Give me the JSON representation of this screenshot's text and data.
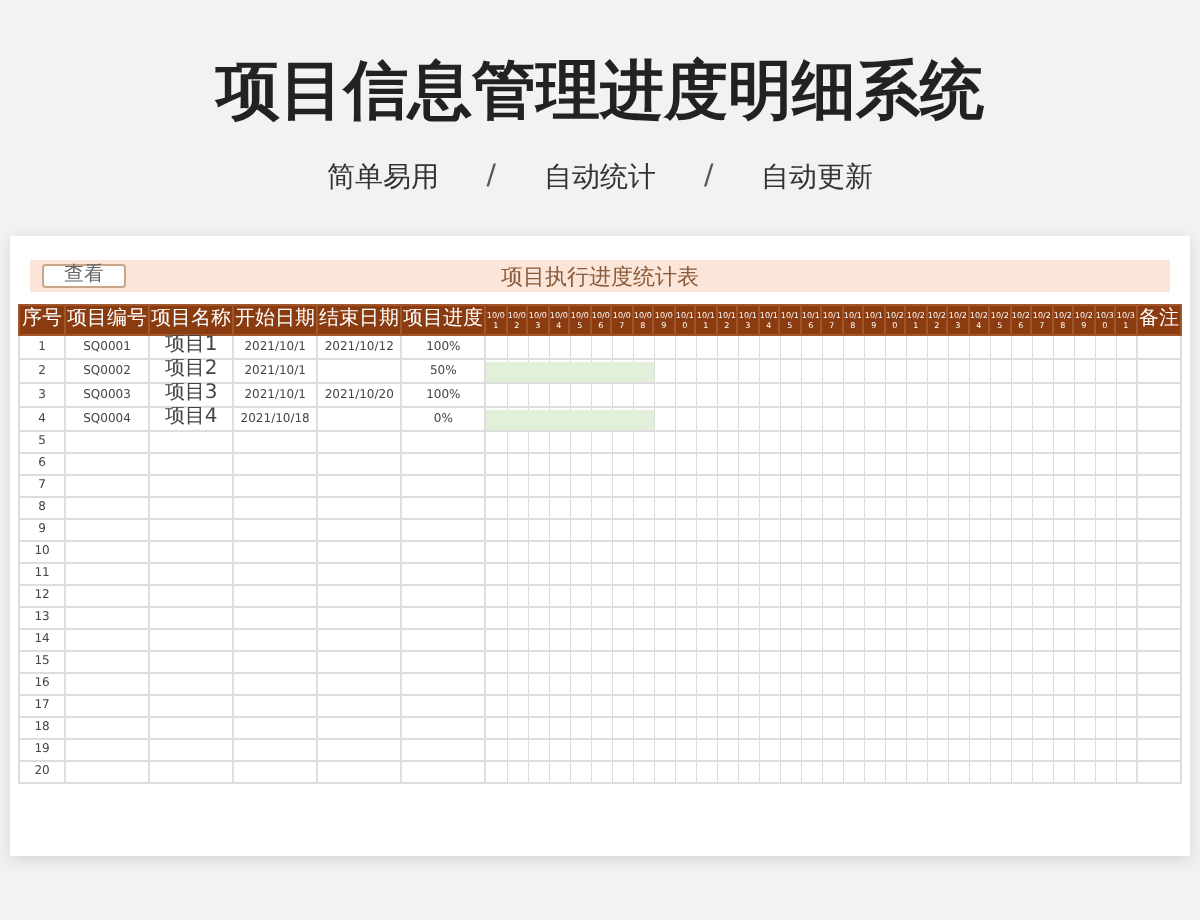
{
  "title": "项目信息管理进度明细系统",
  "features": [
    "简单易用",
    "自动统计",
    "自动更新"
  ],
  "separators": [
    "/",
    "/"
  ],
  "sheet": {
    "button": "查看",
    "title": "项目执行进度统计表",
    "columns": [
      "序号",
      "项目编号",
      "项目名称",
      "开始日期",
      "结束日期",
      "项目进度"
    ],
    "days": [
      "10/01",
      "10/02",
      "10/03",
      "10/04",
      "10/05",
      "10/06",
      "10/07",
      "10/08",
      "10/09",
      "10/10",
      "10/11",
      "10/12",
      "10/13",
      "10/14",
      "10/15",
      "10/16",
      "10/17",
      "10/18",
      "10/19",
      "10/20",
      "10/21",
      "10/22",
      "10/23",
      "10/24",
      "10/25",
      "10/26",
      "10/27",
      "10/28",
      "10/29",
      "10/30",
      "10/31"
    ],
    "note_column": "备注",
    "rows": [
      {
        "no": "1",
        "code": "SQ0001",
        "name": "项目1",
        "start": "2021/10/1",
        "end": "2021/10/12",
        "progress": "100%"
      },
      {
        "no": "2",
        "code": "SQ0002",
        "name": "项目2",
        "start": "2021/10/1",
        "progress": "50%",
        "level": 0.258
      },
      {
        "no": "3",
        "code": "SQ0003",
        "name": "项目3",
        "start": "2021/10/1",
        "end": "2021/10/20",
        "progress": "100%"
      },
      {
        "no": "4",
        "code": "SQ0004",
        "name": "项目4",
        "start": "2021/10/18",
        "progress": "0%",
        "level": 0.258
      },
      {
        "no": "5"
      },
      {
        "no": "6"
      },
      {
        "no": "7"
      },
      {
        "no": "8"
      },
      {
        "no": "9"
      },
      {
        "no": "10"
      },
      {
        "no": "11"
      },
      {
        "no": "12"
      },
      {
        "no": "13"
      },
      {
        "no": "14"
      },
      {
        "no": "15"
      },
      {
        "no": "16"
      },
      {
        "no": "17"
      },
      {
        "no": "18"
      },
      {
        "no": "19"
      },
      {
        "no": "20"
      }
    ]
  }
}
